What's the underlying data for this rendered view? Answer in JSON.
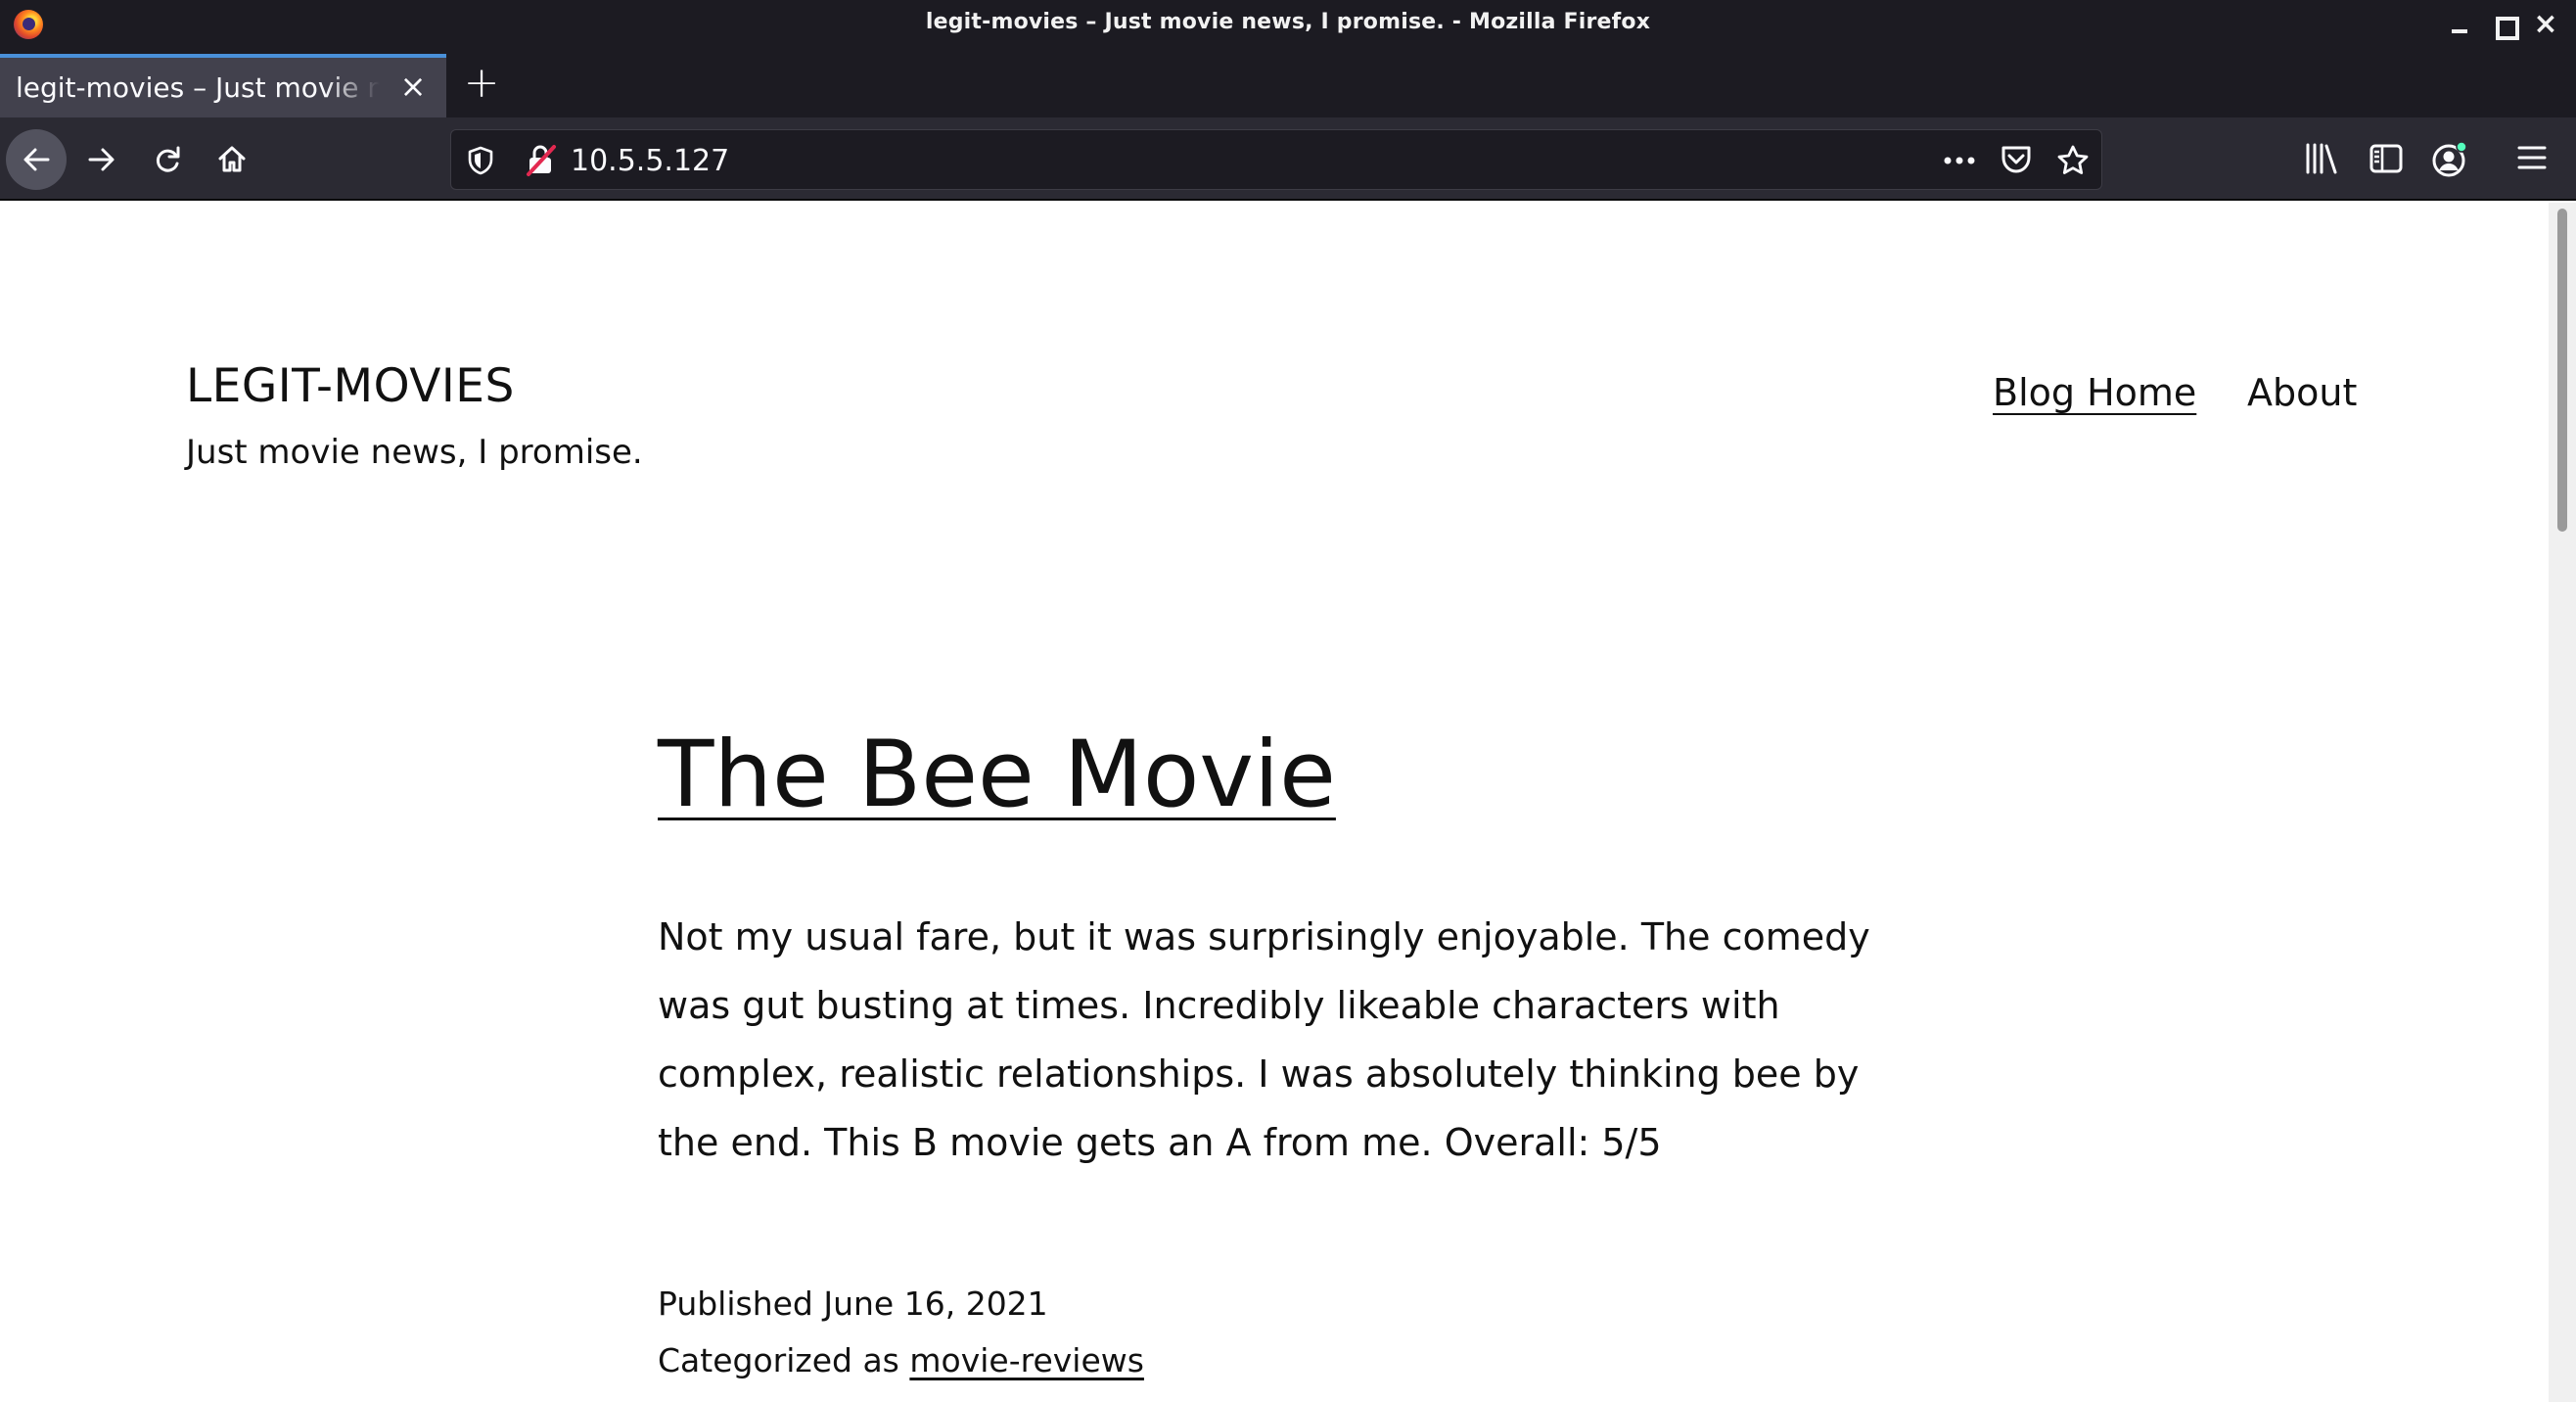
{
  "window": {
    "title": "legit-movies – Just movie news, I promise. - Mozilla Firefox",
    "controls": [
      "minimize-icon",
      "maximize-icon",
      "close-icon"
    ]
  },
  "tabs": [
    {
      "title": "legit-movies – Just movie news, I promise.",
      "active": true
    }
  ],
  "toolbar": {
    "url": "10.5.5.127",
    "icons": [
      "back-icon",
      "forward-icon",
      "reload-icon",
      "home-icon",
      "tracking-shield-icon",
      "insecure-lock-icon",
      "more-icon",
      "pocket-icon",
      "bookmark-star-icon",
      "library-icon",
      "sidebar-icon",
      "account-icon",
      "hamburger-menu-icon"
    ]
  },
  "colors": {
    "chrome_dark": "#1c1b22",
    "toolbar": "#2b2a33",
    "active_tab": "#42414d",
    "tab_accent": "#4a90d9",
    "page_bg": "#ffffff",
    "text": "#111111"
  },
  "site": {
    "title": "LEGIT-MOVIES",
    "tagline": "Just movie news, I promise.",
    "nav": {
      "home": "Blog Home",
      "about": "About"
    }
  },
  "post": {
    "title": "The Bee Movie",
    "body": "Not my usual fare, but it was surprisingly enjoyable. The comedy was gut busting at times. Incredibly likeable characters with complex, realistic relationships. I was absolutely thinking bee by the end. This B movie gets an A from me. Overall: 5/5",
    "published": "Published June 16, 2021",
    "category_prefix": "Categorized as",
    "category": "movie-reviews"
  }
}
